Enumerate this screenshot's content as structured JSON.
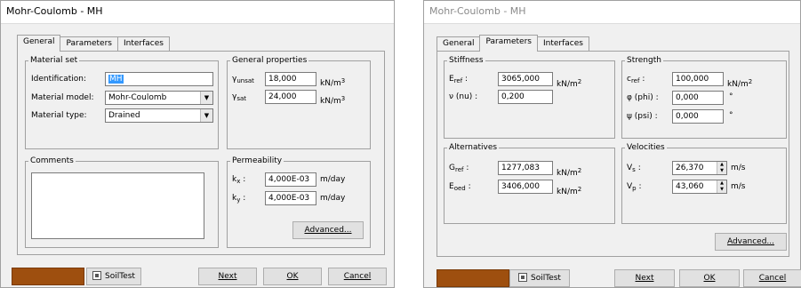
{
  "dialog1": {
    "title": "Mohr-Coulomb - MH",
    "tabs": [
      "General",
      "Parameters",
      "Interfaces"
    ],
    "material_set": {
      "title": "Material set",
      "identification_label": "Identification:",
      "identification_value": "MH",
      "model_label": "Material model:",
      "model_value": "Mohr-Coulomb",
      "type_label": "Material type:",
      "type_value": "Drained"
    },
    "general_properties": {
      "title": "General properties",
      "gamma_sym": "γ",
      "unsat_sub": "unsat",
      "unsat_value": "18,000",
      "sat_sub": "sat",
      "sat_value": "24,000",
      "unit_main": "kN/m",
      "unit_exp": "3"
    },
    "comments": {
      "title": "Comments"
    },
    "permeability": {
      "title": "Permeability",
      "k": "k",
      "kx_sub": "x",
      "kx_value": "4,000E-03",
      "ky_sub": "y",
      "ky_value": "4,000E-03",
      "unit": "m/day",
      "advanced": "Advanced..."
    },
    "footer": {
      "soiltest": "SoilTest",
      "next": "Next",
      "ok": "OK",
      "cancel": "Cancel"
    }
  },
  "dialog2": {
    "title": "Mohr-Coulomb - MH",
    "tabs": [
      "General",
      "Parameters",
      "Interfaces"
    ],
    "stiffness": {
      "title": "Stiffness",
      "eref_main": "E",
      "eref_sub": "ref",
      "eref_value": "3065,000",
      "nu_label": "ν (nu) :",
      "nu_value": "0,200",
      "unit_main": "kN/m",
      "unit_exp": "2"
    },
    "strength": {
      "title": "Strength",
      "cref_main": "c",
      "cref_sub": "ref",
      "cref_value": "100,000",
      "phi_label": "φ (phi) :",
      "phi_value": "0,000",
      "psi_label": "ψ (psi) :",
      "psi_value": "0,000",
      "deg": "°",
      "unit_main": "kN/m",
      "unit_exp": "2"
    },
    "alternatives": {
      "title": "Alternatives",
      "gref_main": "G",
      "gref_sub": "ref",
      "gref_value": "1277,083",
      "eoed_main": "E",
      "eoed_sub": "oed",
      "eoed_value": "3406,000",
      "unit_main": "kN/m",
      "unit_exp": "2"
    },
    "velocities": {
      "title": "Velocities",
      "vs_main": "V",
      "vs_sub": "s",
      "vs_value": "26,370",
      "vp_main": "V",
      "vp_sub": "p",
      "vp_value": "43,060",
      "unit": "m/s"
    },
    "advanced": "Advanced...",
    "footer": {
      "soiltest": "SoilTest",
      "next": "Next",
      "ok": "OK",
      "cancel": "Cancel"
    }
  },
  "colors": {
    "material_swatch": "#9e4f0f",
    "selection": "#3399ff"
  }
}
